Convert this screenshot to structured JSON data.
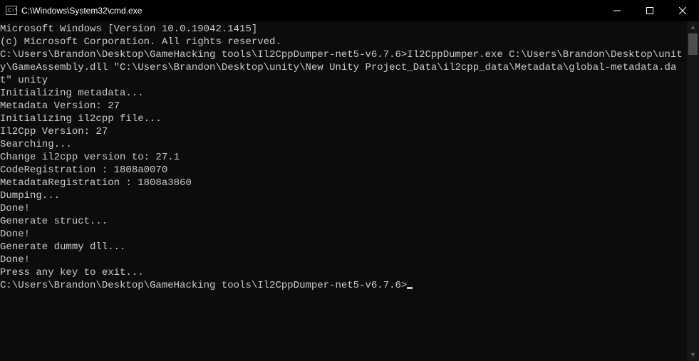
{
  "window": {
    "title": "C:\\Windows\\System32\\cmd.exe"
  },
  "terminal": {
    "lines": [
      "Microsoft Windows [Version 10.0.19042.1415]",
      "(c) Microsoft Corporation. All rights reserved.",
      "",
      "C:\\Users\\Brandon\\Desktop\\GameHacking tools\\Il2CppDumper-net5-v6.7.6>Il2CppDumper.exe C:\\Users\\Brandon\\Desktop\\unity\\GameAssembly.dll \"C:\\Users\\Brandon\\Desktop\\unity\\New Unity Project_Data\\il2cpp_data\\Metadata\\global-metadata.dat\" unity",
      "Initializing metadata...",
      "Metadata Version: 27",
      "Initializing il2cpp file...",
      "Il2Cpp Version: 27",
      "Searching...",
      "Change il2cpp version to: 27.1",
      "CodeRegistration : 1808a0070",
      "MetadataRegistration : 1808a3860",
      "Dumping...",
      "Done!",
      "Generate struct...",
      "Done!",
      "Generate dummy dll...",
      "Done!",
      "Press any key to exit...",
      ""
    ],
    "prompt": "C:\\Users\\Brandon\\Desktop\\GameHacking tools\\Il2CppDumper-net5-v6.7.6>"
  }
}
